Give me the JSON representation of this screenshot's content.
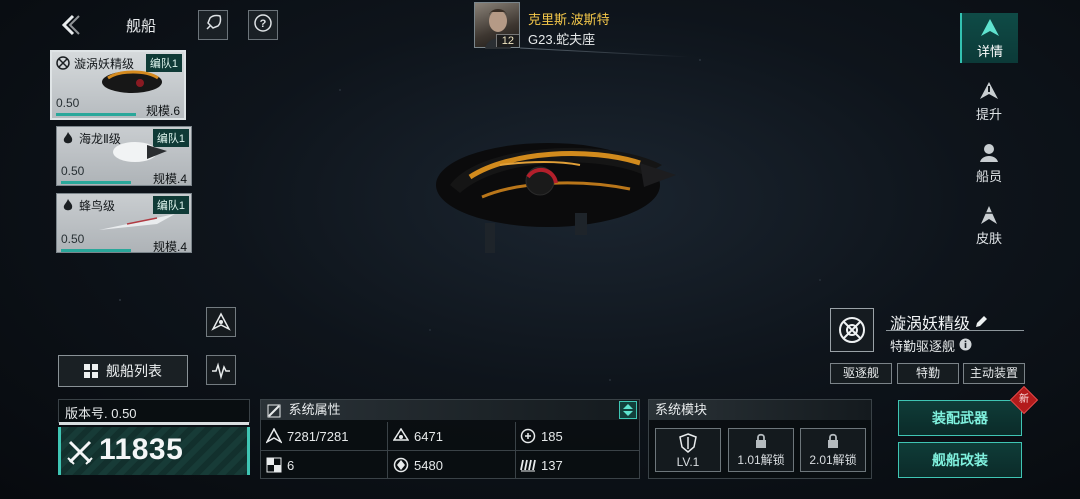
{
  "header": {
    "back_icon": "back-chevron-icon",
    "title": "舰船",
    "rocket_icon": "rocket-icon",
    "help_icon": "help-icon"
  },
  "commander": {
    "name": "克里斯.波斯特",
    "level": "12",
    "location": "G23.蛇夫座"
  },
  "ship_cards": [
    {
      "name": "漩涡妖精级",
      "fleet": "编队1",
      "version": "0.50",
      "scale": "规模.6",
      "class_icon": "crosshair-icon",
      "selected": true
    },
    {
      "name": "海龙Ⅱ级",
      "fleet": "编队1",
      "version": "0.50",
      "scale": "规模.4",
      "class_icon": "flame-icon",
      "selected": false
    },
    {
      "name": "蜂鸟级",
      "fleet": "编队1",
      "version": "0.50",
      "scale": "规模.4",
      "class_icon": "flame-icon",
      "selected": false
    }
  ],
  "side_tabs": [
    {
      "label": "详情",
      "icon": "detail-ship-icon",
      "active": true
    },
    {
      "label": "提升",
      "icon": "upgrade-icon",
      "active": false
    },
    {
      "label": "船员",
      "icon": "crew-icon",
      "active": false
    },
    {
      "label": "皮肤",
      "icon": "skin-icon",
      "active": false
    }
  ],
  "ship_info": {
    "name": "漩涡妖精级",
    "type": "特勤驱逐舰",
    "tags": [
      "驱逐舰",
      "特勤",
      "主动装置"
    ]
  },
  "controls": {
    "ship_list_label": "舰船列表"
  },
  "power": {
    "version_label": "版本号. 0.50",
    "value": "11835"
  },
  "system_attributes": {
    "title": "系统属性",
    "stats": [
      {
        "icon": "hull-icon",
        "value": "7281/7281"
      },
      {
        "icon": "armor-icon",
        "value": "6471"
      },
      {
        "icon": "shield-icon",
        "value": "185"
      },
      {
        "icon": "checker-icon",
        "value": "6"
      },
      {
        "icon": "energy-icon",
        "value": "5480"
      },
      {
        "icon": "speed-icon",
        "value": "137"
      }
    ]
  },
  "system_modules": {
    "title": "系统模块",
    "modules": [
      {
        "label": "LV.1",
        "locked": false
      },
      {
        "label": "1.01解锁",
        "locked": true
      },
      {
        "label": "2.01解锁",
        "locked": true
      }
    ]
  },
  "actions": {
    "equip_weapons": "装配武器",
    "modify_ship": "舰船改装",
    "new_badge": "新"
  },
  "colors": {
    "accent": "#3fc5b4",
    "commander_name": "#f3c74a",
    "badge": "#b31b1b"
  }
}
